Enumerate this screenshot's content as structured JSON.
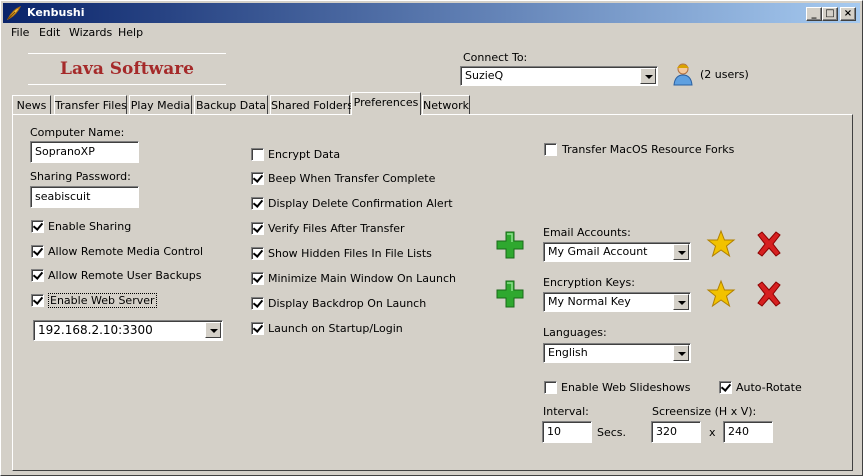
{
  "window": {
    "title": "Kenbushi",
    "icon": "feather-icon"
  },
  "titlebar_buttons": {
    "minimize": "_",
    "maximize": "□",
    "close": "×"
  },
  "menu": [
    "File",
    "Edit",
    "Wizards",
    "Help"
  ],
  "logo": {
    "text": "Lava Software"
  },
  "connect": {
    "label": "Connect To:",
    "value": "SuzieQ",
    "users": "(2 users)"
  },
  "tabs": [
    "News",
    "Transfer Files",
    "Play Media",
    "Backup Data",
    "Shared Folders",
    "Preferences",
    "Network"
  ],
  "active_tab": "Preferences",
  "left": {
    "computer_name_label": "Computer Name:",
    "computer_name_value": "SopranoXP",
    "sharing_password_label": "Sharing Password:",
    "sharing_password_value": "seabiscuit",
    "checkboxes": [
      {
        "label": "Enable Sharing",
        "checked": true
      },
      {
        "label": "Allow Remote Media Control",
        "checked": true
      },
      {
        "label": "Allow Remote User Backups",
        "checked": true
      },
      {
        "label": "Enable Web Server",
        "checked": true
      }
    ],
    "web_server_address": "192.168.2.10:3300"
  },
  "middle": {
    "checkboxes": [
      {
        "label": "Encrypt Data",
        "checked": false
      },
      {
        "label": "Beep When Transfer Complete",
        "checked": true
      },
      {
        "label": "Display Delete Confirmation Alert",
        "checked": true
      },
      {
        "label": "Verify Files After Transfer",
        "checked": true
      },
      {
        "label": "Show Hidden Files In File Lists",
        "checked": true
      },
      {
        "label": "Minimize Main Window On Launch",
        "checked": true
      },
      {
        "label": "Display Backdrop On Launch",
        "checked": true
      },
      {
        "label": "Launch on Startup/Login",
        "checked": true
      }
    ]
  },
  "right": {
    "macos_forks": {
      "label": "Transfer MacOS Resource Forks",
      "checked": false
    },
    "email_accounts_label": "Email Accounts:",
    "email_accounts_value": "My Gmail Account",
    "encryption_keys_label": "Encryption Keys:",
    "encryption_keys_value": "My Normal Key",
    "languages_label": "Languages:",
    "languages_value": "English",
    "web_slideshows": {
      "label": "Enable Web Slideshows",
      "checked": false
    },
    "auto_rotate": {
      "label": "Auto-Rotate",
      "checked": true
    },
    "interval_label": "Interval:",
    "interval_value": "10",
    "secs_label": "Secs.",
    "screensize_label": "Screensize (H x V):",
    "screen_h": "320",
    "times": "x",
    "screen_v": "240"
  },
  "colors": {
    "title_start": "#0a246a",
    "title_end": "#a6caf0",
    "logo": "#a52a2a",
    "add_green": "#2fa82f",
    "delete_red": "#d62020",
    "star_gold": "#f2c200"
  }
}
